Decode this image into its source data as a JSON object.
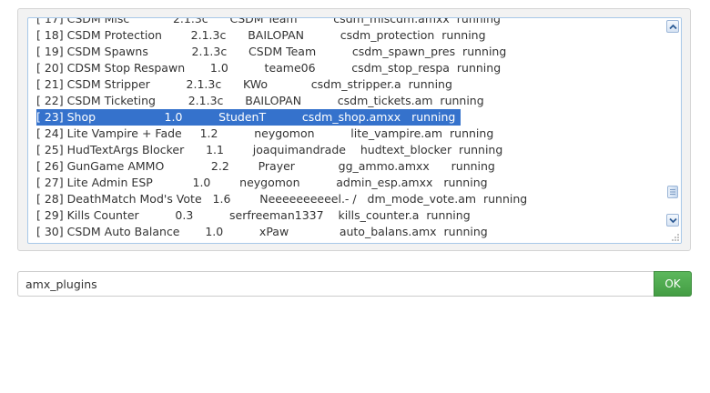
{
  "console": {
    "lines": [
      "[ 17] CSDM Misc            2.1.3c      CSDM Team          csdm_miscdm.amxx  running",
      "[ 18] CSDM Protection        2.1.3c      BAILOPAN          csdm_protection  running",
      "[ 19] CSDM Spawns            2.1.3c      CSDM Team          csdm_spawn_pres  running",
      "[ 20] CDSM Stop Respawn       1.0          teame06          csdm_stop_respa  running",
      "[ 21] CSDM Stripper          2.1.3c      KWo            csdm_stripper.a  running",
      "[ 22] CSDM Ticketing         2.1.3c      BAILOPAN          csdm_tickets.am  running",
      "[ 23] Shop                   1.0          StudenT          csdm_shop.amxx   running",
      "[ 24] Lite Vampire + Fade     1.2          neygomon          lite_vampire.am  running",
      "[ 25] HudTextArgs Blocker      1.1        joaquimandrade    hudtext_blocker  running",
      "[ 26] GunGame AMMO             2.2        Prayer            gg_ammo.amxx      running",
      "[ 27] Lite Admin ESP           1.0        neygomon          admin_esp.amxx   running",
      "[ 28] DeathMatch Mod's Vote   1.6        Neeeeeeeeeel.- /   dm_mode_vote.am  running",
      "[ 29] Kills Counter          0.3          serfreeman1337    kills_counter.a  running",
      "[ 30] CSDM Auto Balance       1.0          xPaw              auto_balans.amx  running"
    ],
    "selected_index": 6
  },
  "command": {
    "value": "amx_plugins"
  },
  "ok_button": {
    "label": "OK"
  },
  "icons": {
    "scroll_up": "chevron-up-icon",
    "scroll_down": "chevron-down-icon",
    "resize": "resize-grip-icon"
  },
  "colors": {
    "selection": "#3572cc",
    "ok_button": "#5cb85c"
  }
}
